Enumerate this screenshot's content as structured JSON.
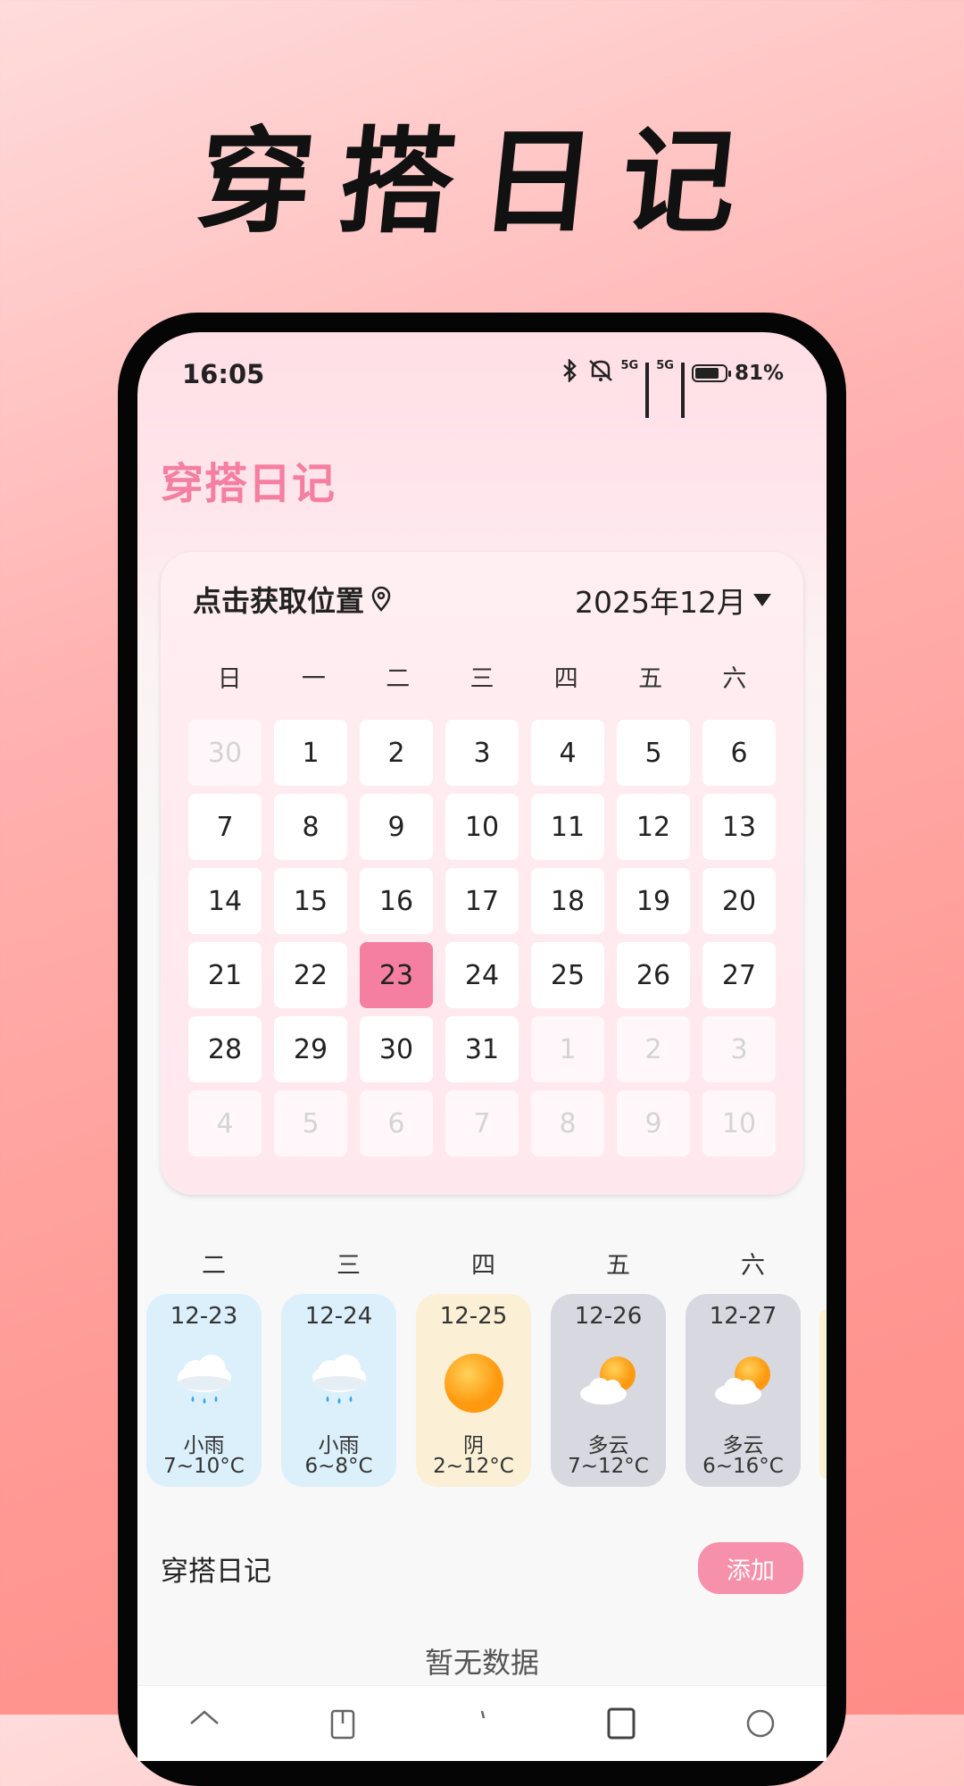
{
  "promo": {
    "headline": "穿搭日记"
  },
  "status_bar": {
    "time": "16:05",
    "network": "5G",
    "network2": "5G",
    "battery": "81%"
  },
  "app": {
    "title": "穿搭日记"
  },
  "calendar": {
    "location_label": "点击获取位置",
    "month_label": "2025年12月",
    "weekdays": [
      "日",
      "一",
      "二",
      "三",
      "四",
      "五",
      "六"
    ],
    "days": [
      {
        "d": "30",
        "muted": true
      },
      {
        "d": "1"
      },
      {
        "d": "2"
      },
      {
        "d": "3"
      },
      {
        "d": "4"
      },
      {
        "d": "5"
      },
      {
        "d": "6"
      },
      {
        "d": "7"
      },
      {
        "d": "8"
      },
      {
        "d": "9"
      },
      {
        "d": "10"
      },
      {
        "d": "11"
      },
      {
        "d": "12"
      },
      {
        "d": "13"
      },
      {
        "d": "14"
      },
      {
        "d": "15"
      },
      {
        "d": "16"
      },
      {
        "d": "17"
      },
      {
        "d": "18"
      },
      {
        "d": "19"
      },
      {
        "d": "20"
      },
      {
        "d": "21"
      },
      {
        "d": "22"
      },
      {
        "d": "23",
        "today": true
      },
      {
        "d": "24"
      },
      {
        "d": "25"
      },
      {
        "d": "26"
      },
      {
        "d": "27"
      },
      {
        "d": "28"
      },
      {
        "d": "29"
      },
      {
        "d": "30"
      },
      {
        "d": "31"
      },
      {
        "d": "1",
        "muted": true
      },
      {
        "d": "2",
        "muted": true
      },
      {
        "d": "3",
        "muted": true
      },
      {
        "d": "4",
        "muted": true
      },
      {
        "d": "5",
        "muted": true
      },
      {
        "d": "6",
        "muted": true
      },
      {
        "d": "7",
        "muted": true
      },
      {
        "d": "8",
        "muted": true
      },
      {
        "d": "9",
        "muted": true
      },
      {
        "d": "10",
        "muted": true
      }
    ]
  },
  "forecast": {
    "days": [
      {
        "weekday": "二",
        "date": "12-23",
        "desc": "小雨",
        "temp": "7~10°C",
        "kind": "rainy",
        "icon": "rain-cloud-icon"
      },
      {
        "weekday": "三",
        "date": "12-24",
        "desc": "小雨",
        "temp": "6~8°C",
        "kind": "rainy",
        "icon": "rain-cloud-icon"
      },
      {
        "weekday": "四",
        "date": "12-25",
        "desc": "阴",
        "temp": "2~12°C",
        "kind": "sunny",
        "icon": "sun-icon"
      },
      {
        "weekday": "五",
        "date": "12-26",
        "desc": "多云",
        "temp": "7~12°C",
        "kind": "cloudy",
        "icon": "partly-cloudy-icon"
      },
      {
        "weekday": "六",
        "date": "12-27",
        "desc": "多云",
        "temp": "6~16°C",
        "kind": "cloudy",
        "icon": "partly-cloudy-icon"
      }
    ]
  },
  "diary": {
    "label": "穿搭日记",
    "add_label": "添加",
    "empty_text": "暂无数据"
  },
  "colors": {
    "accent": "#f47fa0",
    "add_button": "#f790aa"
  }
}
